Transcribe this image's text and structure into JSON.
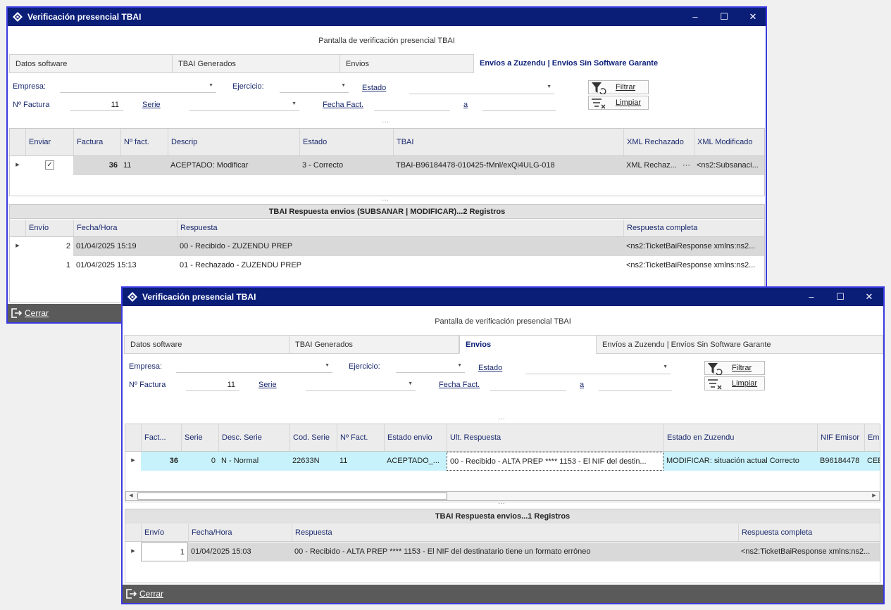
{
  "win1": {
    "title": "Verificación presencial TBAI",
    "header": "Pantalla de verificación presencial TBAI",
    "tabs": [
      "Datos software",
      "TBAI Generados",
      "Envios",
      "Envíos a Zuzendu | Envíos Sin Software Garante"
    ],
    "active_tab": 3,
    "filters": {
      "empresa_label": "Empresa:",
      "empresa_value": "",
      "ejercicio_label": "Ejercicio:",
      "ejercicio_value": "",
      "estado_label": "Estado",
      "estado_value": "",
      "nfactura_label": "Nº Factura",
      "nfactura_value": "11",
      "serie_label": "Serie",
      "serie_value": "",
      "fecha_label": "Fecha Fact.",
      "fecha_value": "",
      "a_label": "a",
      "a_value": ""
    },
    "buttons": {
      "filtrar": "Filtrar",
      "limpiar": "Limpiar"
    },
    "grid": {
      "columns": [
        "Enviar",
        "Factura",
        "Nº fact.",
        "Descrip",
        "Estado",
        "TBAI",
        "XML Rechazado",
        "XML Modificado"
      ],
      "rows": [
        {
          "enviar": true,
          "factura": "36",
          "nfact": "11",
          "descrip": "ACEPTADO: Modificar",
          "estado": "3 - Correcto",
          "tbai": "TBAI-B96184478-010425-fMnl/exQi4ULG-018",
          "xml_rech": "XML Rechaz...",
          "xml_mod": "<ns2:Subsanaci..."
        }
      ]
    },
    "resp": {
      "title": "TBAI Respuesta envios (SUBSANAR | MODIFICAR)...2 Registros",
      "columns": [
        "Envío",
        "Fecha/Hora",
        "Respuesta",
        "Respuesta completa"
      ],
      "rows": [
        {
          "envio": "2",
          "fecha": "01/04/2025 15:19",
          "respuesta": "00 - Recibido - ZUZENDU PREP",
          "completa": "<ns2:TicketBaiResponse xmlns:ns2..."
        },
        {
          "envio": "1",
          "fecha": "01/04/2025 15:13",
          "respuesta": "01 - Rechazado - ZUZENDU PREP",
          "completa": "<ns2:TicketBaiResponse xmlns:ns2..."
        }
      ]
    },
    "footer": "Cerrar"
  },
  "win2": {
    "title": "Verificación presencial TBAI",
    "header": "Pantalla de verificación presencial TBAI",
    "tabs": [
      "Datos software",
      "TBAI Generados",
      "Envios",
      "Envíos a Zuzendu | Envíos Sin Software Garante"
    ],
    "active_tab": 2,
    "filters": {
      "empresa_label": "Empresa:",
      "empresa_value": "",
      "ejercicio_label": "Ejercicio:",
      "ejercicio_value": "",
      "estado_label": "Estado",
      "estado_value": "",
      "nfactura_label": "Nº Factura",
      "nfactura_value": "11",
      "serie_label": "Serie",
      "serie_value": "",
      "fecha_label": "Fecha Fact.",
      "fecha_value": "",
      "a_label": "a",
      "a_value": ""
    },
    "buttons": {
      "filtrar": "Filtrar",
      "limpiar": "Limpiar"
    },
    "grid": {
      "columns": [
        "Fact...",
        "Serie",
        "Desc. Serie",
        "Cod. Serie",
        "Nº Fact.",
        "Estado envio",
        "Ult. Respuesta",
        "Estado en Zuzendu",
        "NIF Emisor",
        "Em"
      ],
      "rows": [
        {
          "fact": "36",
          "serie": "0",
          "desc": "N - Normal",
          "cod": "22633N",
          "nfact": "11",
          "estado": "ACEPTADO_...",
          "ult": "00 - Recibido - ALTA PREP **** 1153 - El NIF del destin...",
          "zuzendu": "MODIFICAR: situación actual Correcto",
          "nif": "B96184478",
          "em": "CEE"
        }
      ]
    },
    "resp": {
      "title": "TBAI Respuesta envios...1 Registros",
      "columns": [
        "Envío",
        "Fecha/Hora",
        "Respuesta",
        "Respuesta completa"
      ],
      "rows": [
        {
          "envio": "1",
          "fecha": "01/04/2025 15:03",
          "respuesta": "00 - Recibido - ALTA PREP **** 1153 - El NIF del destinatario tiene un formato erróneo",
          "completa": "<ns2:TicketBaiResponse xmlns:ns2..."
        }
      ]
    },
    "footer": "Cerrar"
  },
  "window_controls": {
    "minimize": "–",
    "maximize": "☐",
    "close": "✕"
  },
  "colors": {
    "titlebar": "#0a1e78",
    "window_border": "#3a3ae0",
    "selected_row": "#c8f2fb",
    "status_green": "#1a9a1a"
  },
  "icons": [
    "app-logo-icon",
    "filter-icon",
    "clear-filter-icon",
    "exit-icon",
    "dropdown-arrow-icon",
    "row-indicator-icon",
    "checkbox-checked-icon"
  ]
}
